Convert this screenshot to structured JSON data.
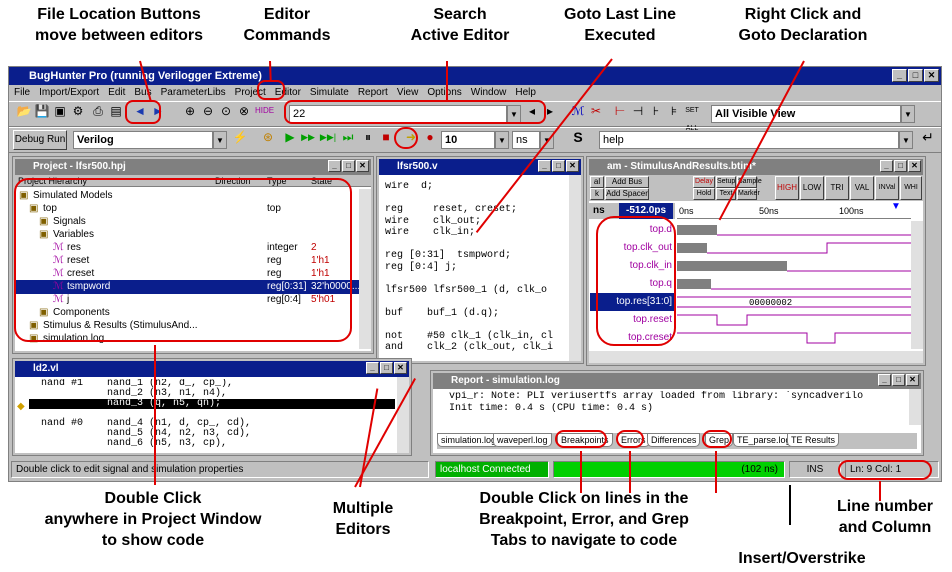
{
  "annotations": {
    "file_location": "File Location Buttons\nmove between editors",
    "editor_commands": "Editor\nCommands",
    "search": "Search\nActive Editor",
    "goto_last": "Goto Last Line\nExecuted",
    "right_click": "Right Click and\nGoto Declaration",
    "double_click_project": "Double Click\nanywhere in Project Window\nto show code",
    "multiple_editors": "Multiple\nEditors",
    "double_click_tabs": "Double Click on lines in the\nBreakpoint, Error, and Grep\nTabs to navigate to code",
    "line_number": "Line number\nand Column",
    "insert_overstrike": "Insert/Overstrike"
  },
  "app": {
    "title": "BugHunter Pro (running Verilogger Extreme)",
    "menu": [
      "File",
      "Import/Export",
      "Edit",
      "Bus",
      "ParameterLibs",
      "Project",
      "Editor",
      "Simulate",
      "Report",
      "View",
      "Options",
      "Window",
      "Help"
    ]
  },
  "toolbar1": {
    "search_value": "22",
    "view_select": "All Visible View"
  },
  "toolbar2": {
    "debug_run": "Debug Run",
    "language": "Verilog",
    "sim_time": "10",
    "unit": "ns",
    "help_value": "help",
    "s_label": "S"
  },
  "project": {
    "title": "Project - lfsr500.hpj",
    "columns": [
      "Project Hierarchy",
      "Direction",
      "Type",
      "State"
    ],
    "rows": [
      {
        "name": "Simulated Models",
        "type": "",
        "state": ""
      },
      {
        "name": "top",
        "type": "top",
        "state": ""
      },
      {
        "name": "Signals",
        "type": "",
        "state": ""
      },
      {
        "name": "Variables",
        "type": "",
        "state": ""
      },
      {
        "name": "res",
        "type": "integer",
        "state": "2"
      },
      {
        "name": "reset",
        "type": "reg",
        "state": "1'h1"
      },
      {
        "name": "creset",
        "type": "reg",
        "state": "1'h1"
      },
      {
        "name": "tsmpword",
        "type": "reg[0:31]",
        "state": "32'h0000..."
      },
      {
        "name": "j",
        "type": "reg[0:4]",
        "state": "5'h01"
      },
      {
        "name": "Components",
        "type": "",
        "state": ""
      },
      {
        "name": "Stimulus & Results (StimulusAnd...",
        "type": "",
        "state": ""
      },
      {
        "name": "simulation.log",
        "type": "",
        "state": ""
      }
    ]
  },
  "editor1": {
    "title": "lfsr500.v",
    "lines": [
      "wire  d;",
      "",
      "reg     reset, creset;",
      "wire    clk_out;",
      "wire    clk_in;",
      "",
      "reg [0:31]  tsmpword;",
      "reg [0:4] j;",
      "",
      "lfsr500 lfsr500_1 (d, clk_o",
      "",
      "buf    buf_1 (d.q);",
      "",
      "not    #50 clk_1 (clk_in, cl",
      "and    clk_2 (clk_out, clk_i"
    ]
  },
  "timing": {
    "title": "am - StimulusAndResults.btim*",
    "buttons": [
      "al",
      "Add Bus",
      "k",
      "Add Spacer",
      "Delay",
      "Setup",
      "Sample",
      "Hold",
      "Text",
      "Marker"
    ],
    "shapes": [
      "HIGH",
      "LOW",
      "TRI",
      "VAL",
      "INVal",
      "WHI"
    ],
    "time_unit": "ns",
    "time_value": "-512.0ps",
    "ruler": [
      "0ns",
      "50ns",
      "100ns"
    ],
    "signals": [
      "top.d",
      "top.clk_out",
      "top.clk_in",
      "top.q",
      "top.res[31:0]",
      "top.reset",
      "top.creset"
    ],
    "bus_value": "00000002"
  },
  "editor2": {
    "title": "ld2.vl",
    "lines": [
      "  nand #1    nand_1 (n2, d_, cp_),",
      "             nand_2 (n3, n1, n4),",
      "             nand_3 (q, n5, qn);",
      "",
      "  nand #0    nand_4 (n1, d, cp_, cd),",
      "             nand_5 (n4, n2, n3, cd),",
      "             nand_6 (n5, n3, cp),"
    ]
  },
  "report": {
    "title": "Report - simulation.log",
    "lines": [
      "vpi_r: Note: PLI veriusertfs array loaded from library: `syncadverilo",
      "Init time: 0.4 s (CPU time: 0.4 s)"
    ],
    "tabs": [
      "simulation.log",
      "waveperl.log",
      "Breakpoints",
      "Errors",
      "Differences",
      "Grep",
      "TE_parse.log",
      "TE Results"
    ]
  },
  "status": {
    "hint": "Double click to edit signal and simulation properties",
    "connection": "localhost Connected",
    "progress": "(102 ns)",
    "mode": "INS",
    "position": "Ln: 9  Col: 1"
  },
  "colors": {
    "annotation": "#e00000",
    "titlebar": "#0a1e8c",
    "progress": "#00d000"
  }
}
